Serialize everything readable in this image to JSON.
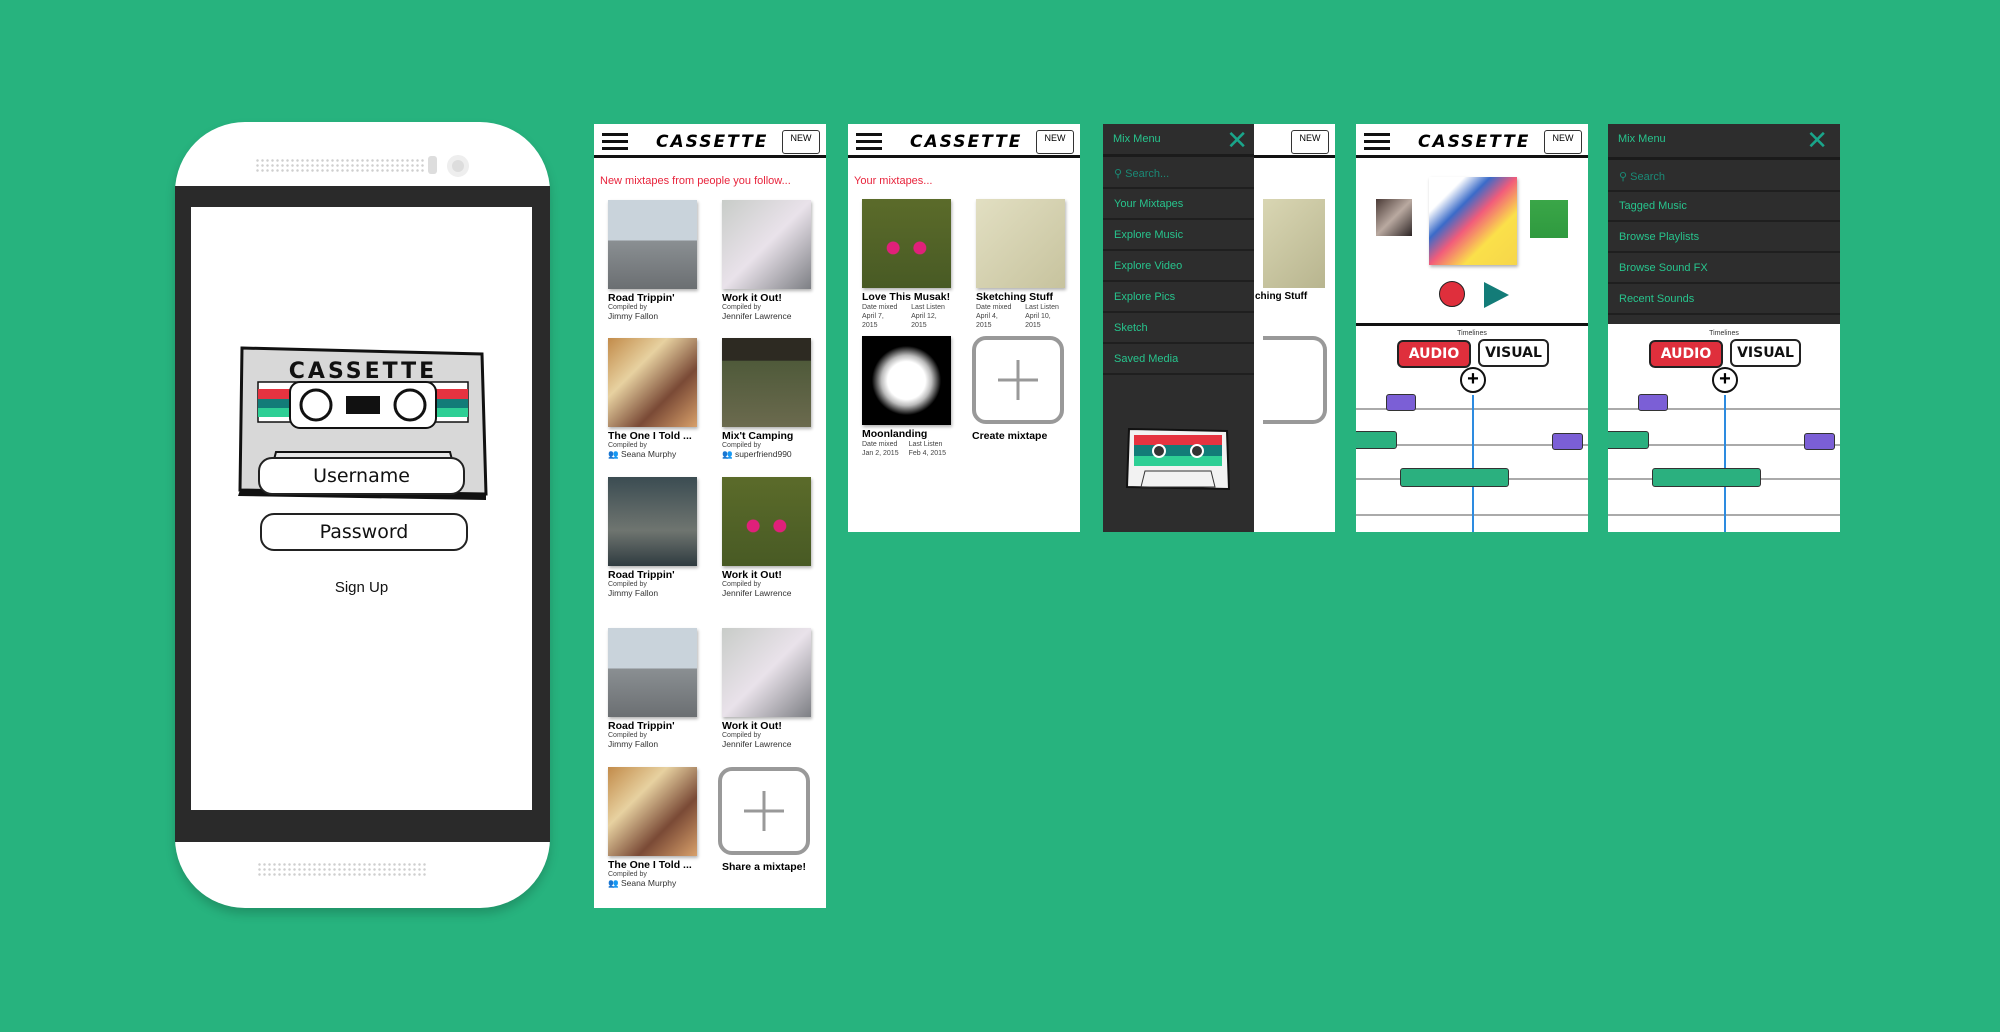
{
  "app": {
    "logo_text": "CASSETTE",
    "new_button": "NEW"
  },
  "login": {
    "username_placeholder": "Username",
    "password_placeholder": "Password",
    "signup_link": "Sign Up"
  },
  "feed": {
    "section_title": "New mixtapes from people you follow...",
    "compiled_by_label": "Compiled by",
    "cards": [
      {
        "title": "Road Trippin'",
        "author": "Jimmy Fallon",
        "group": false
      },
      {
        "title": "Work it Out!",
        "author": "Jennifer Lawrence",
        "group": false
      },
      {
        "title": "The One I Told ...",
        "author": "Seana Murphy",
        "group": true
      },
      {
        "title": "Mix't Camping",
        "author": "superfriend990",
        "group": true
      },
      {
        "title": "Road Trippin'",
        "author": "Jimmy Fallon",
        "group": false
      },
      {
        "title": "Work it Out!",
        "author": "Jennifer Lawrence",
        "group": false
      },
      {
        "title": "Road Trippin'",
        "author": "Jimmy Fallon",
        "group": false
      },
      {
        "title": "Work it Out!",
        "author": "Jennifer Lawrence",
        "group": false
      },
      {
        "title": "The One I Told ...",
        "author": "Seana Murphy",
        "group": true
      }
    ],
    "share_label": "Share a mixtape!"
  },
  "mine": {
    "section_title": "Your mixtapes...",
    "date_mixed_label": "Date mixed",
    "last_listen_label": "Last Listen",
    "cards": [
      {
        "title": "Love This Musak!",
        "date_mixed": "April 7, 2015",
        "last_listen": "April 12, 2015"
      },
      {
        "title": "Sketching Stuff",
        "date_mixed": "April 4, 2015",
        "last_listen": "April 10, 2015"
      },
      {
        "title": "Moonlanding",
        "date_mixed": "Jan 2, 2015",
        "last_listen": "Feb 4, 2015"
      }
    ],
    "create_label": "Create mixtape"
  },
  "mix_menu": {
    "title": "Mix Menu",
    "search_placeholder": "Search...",
    "items": [
      "Your Mixtapes",
      "Explore Music",
      "Explore Video",
      "Explore Pics",
      "Sketch",
      "Saved Media"
    ]
  },
  "editor": {
    "timelines_label": "Timelines",
    "audio_tab": "AUDIO",
    "visual_tab": "VISUAL"
  },
  "editor_menu": {
    "title": "Mix Menu",
    "search_placeholder": "Search",
    "items": [
      "Tagged Music",
      "Browse Playlists",
      "Browse Sound FX",
      "Recent Sounds"
    ]
  },
  "colors": {
    "background": "#27b37e",
    "accent_red": "#e8243c",
    "menu_text": "#27c48d",
    "menu_bg": "#2d2d2d",
    "audio_block": "#2bb07f",
    "visual_block": "#7b5fd6"
  }
}
